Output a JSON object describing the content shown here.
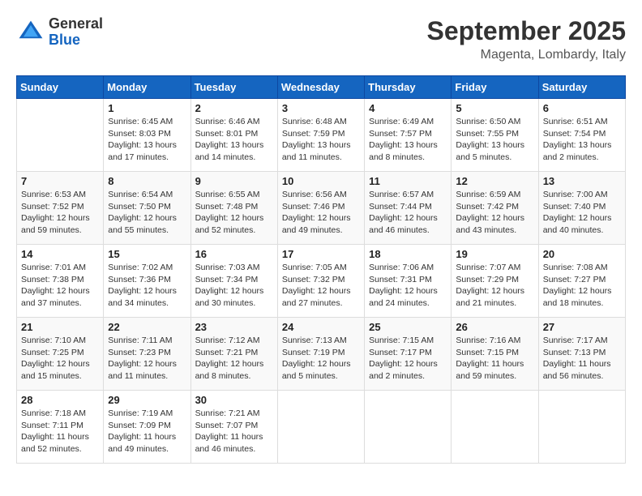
{
  "header": {
    "logo_general": "General",
    "logo_blue": "Blue",
    "month_title": "September 2025",
    "location": "Magenta, Lombardy, Italy"
  },
  "weekdays": [
    "Sunday",
    "Monday",
    "Tuesday",
    "Wednesday",
    "Thursday",
    "Friday",
    "Saturday"
  ],
  "weeks": [
    [
      {
        "day": "",
        "info": ""
      },
      {
        "day": "1",
        "info": "Sunrise: 6:45 AM\nSunset: 8:03 PM\nDaylight: 13 hours\nand 17 minutes."
      },
      {
        "day": "2",
        "info": "Sunrise: 6:46 AM\nSunset: 8:01 PM\nDaylight: 13 hours\nand 14 minutes."
      },
      {
        "day": "3",
        "info": "Sunrise: 6:48 AM\nSunset: 7:59 PM\nDaylight: 13 hours\nand 11 minutes."
      },
      {
        "day": "4",
        "info": "Sunrise: 6:49 AM\nSunset: 7:57 PM\nDaylight: 13 hours\nand 8 minutes."
      },
      {
        "day": "5",
        "info": "Sunrise: 6:50 AM\nSunset: 7:55 PM\nDaylight: 13 hours\nand 5 minutes."
      },
      {
        "day": "6",
        "info": "Sunrise: 6:51 AM\nSunset: 7:54 PM\nDaylight: 13 hours\nand 2 minutes."
      }
    ],
    [
      {
        "day": "7",
        "info": "Sunrise: 6:53 AM\nSunset: 7:52 PM\nDaylight: 12 hours\nand 59 minutes."
      },
      {
        "day": "8",
        "info": "Sunrise: 6:54 AM\nSunset: 7:50 PM\nDaylight: 12 hours\nand 55 minutes."
      },
      {
        "day": "9",
        "info": "Sunrise: 6:55 AM\nSunset: 7:48 PM\nDaylight: 12 hours\nand 52 minutes."
      },
      {
        "day": "10",
        "info": "Sunrise: 6:56 AM\nSunset: 7:46 PM\nDaylight: 12 hours\nand 49 minutes."
      },
      {
        "day": "11",
        "info": "Sunrise: 6:57 AM\nSunset: 7:44 PM\nDaylight: 12 hours\nand 46 minutes."
      },
      {
        "day": "12",
        "info": "Sunrise: 6:59 AM\nSunset: 7:42 PM\nDaylight: 12 hours\nand 43 minutes."
      },
      {
        "day": "13",
        "info": "Sunrise: 7:00 AM\nSunset: 7:40 PM\nDaylight: 12 hours\nand 40 minutes."
      }
    ],
    [
      {
        "day": "14",
        "info": "Sunrise: 7:01 AM\nSunset: 7:38 PM\nDaylight: 12 hours\nand 37 minutes."
      },
      {
        "day": "15",
        "info": "Sunrise: 7:02 AM\nSunset: 7:36 PM\nDaylight: 12 hours\nand 34 minutes."
      },
      {
        "day": "16",
        "info": "Sunrise: 7:03 AM\nSunset: 7:34 PM\nDaylight: 12 hours\nand 30 minutes."
      },
      {
        "day": "17",
        "info": "Sunrise: 7:05 AM\nSunset: 7:32 PM\nDaylight: 12 hours\nand 27 minutes."
      },
      {
        "day": "18",
        "info": "Sunrise: 7:06 AM\nSunset: 7:31 PM\nDaylight: 12 hours\nand 24 minutes."
      },
      {
        "day": "19",
        "info": "Sunrise: 7:07 AM\nSunset: 7:29 PM\nDaylight: 12 hours\nand 21 minutes."
      },
      {
        "day": "20",
        "info": "Sunrise: 7:08 AM\nSunset: 7:27 PM\nDaylight: 12 hours\nand 18 minutes."
      }
    ],
    [
      {
        "day": "21",
        "info": "Sunrise: 7:10 AM\nSunset: 7:25 PM\nDaylight: 12 hours\nand 15 minutes."
      },
      {
        "day": "22",
        "info": "Sunrise: 7:11 AM\nSunset: 7:23 PM\nDaylight: 12 hours\nand 11 minutes."
      },
      {
        "day": "23",
        "info": "Sunrise: 7:12 AM\nSunset: 7:21 PM\nDaylight: 12 hours\nand 8 minutes."
      },
      {
        "day": "24",
        "info": "Sunrise: 7:13 AM\nSunset: 7:19 PM\nDaylight: 12 hours\nand 5 minutes."
      },
      {
        "day": "25",
        "info": "Sunrise: 7:15 AM\nSunset: 7:17 PM\nDaylight: 12 hours\nand 2 minutes."
      },
      {
        "day": "26",
        "info": "Sunrise: 7:16 AM\nSunset: 7:15 PM\nDaylight: 11 hours\nand 59 minutes."
      },
      {
        "day": "27",
        "info": "Sunrise: 7:17 AM\nSunset: 7:13 PM\nDaylight: 11 hours\nand 56 minutes."
      }
    ],
    [
      {
        "day": "28",
        "info": "Sunrise: 7:18 AM\nSunset: 7:11 PM\nDaylight: 11 hours\nand 52 minutes."
      },
      {
        "day": "29",
        "info": "Sunrise: 7:19 AM\nSunset: 7:09 PM\nDaylight: 11 hours\nand 49 minutes."
      },
      {
        "day": "30",
        "info": "Sunrise: 7:21 AM\nSunset: 7:07 PM\nDaylight: 11 hours\nand 46 minutes."
      },
      {
        "day": "",
        "info": ""
      },
      {
        "day": "",
        "info": ""
      },
      {
        "day": "",
        "info": ""
      },
      {
        "day": "",
        "info": ""
      }
    ]
  ]
}
